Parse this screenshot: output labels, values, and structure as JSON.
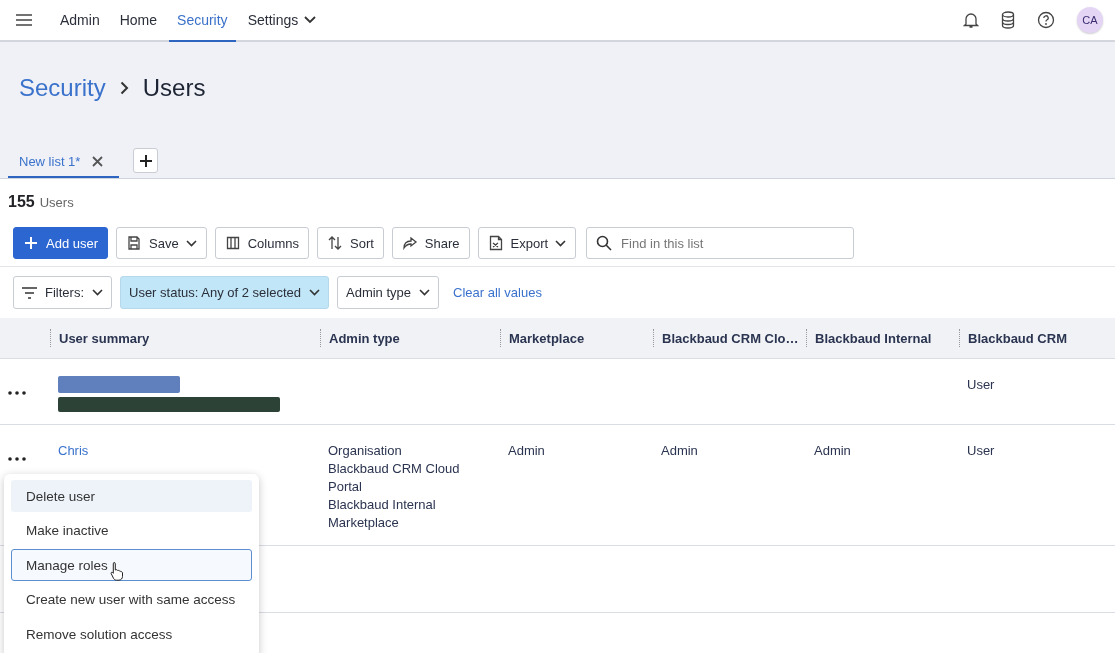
{
  "nav": {
    "items": [
      {
        "label": "Admin",
        "selected": false,
        "dropdown": false
      },
      {
        "label": "Home",
        "selected": false,
        "dropdown": false
      },
      {
        "label": "Security",
        "selected": true,
        "dropdown": false
      },
      {
        "label": "Settings",
        "selected": false,
        "dropdown": true
      }
    ],
    "avatar": "CA"
  },
  "breadcrumb": {
    "parent": "Security",
    "current": "Users"
  },
  "list_tabs": [
    {
      "label": "New list 1*",
      "selected": true
    }
  ],
  "count": {
    "number": "155",
    "label": "Users"
  },
  "toolbar": {
    "buttons": [
      {
        "kind": "primary",
        "label": "Add user",
        "dropdown": false
      },
      {
        "kind": "default",
        "label": "Save",
        "dropdown": true
      },
      {
        "kind": "default",
        "label": "Columns",
        "dropdown": false
      },
      {
        "kind": "default",
        "label": "Sort",
        "dropdown": false
      },
      {
        "kind": "default",
        "label": "Share",
        "dropdown": false
      },
      {
        "kind": "default",
        "label": "Export",
        "dropdown": true
      }
    ],
    "search": {
      "placeholder": "Find in this list"
    }
  },
  "filters": {
    "items": [
      {
        "kind": "menu",
        "label": "Filters:",
        "active": false
      },
      {
        "kind": "filter",
        "label": "User status: Any of 2 selected",
        "active": true
      },
      {
        "kind": "filter",
        "label": "Admin type",
        "active": false
      }
    ],
    "clear": "Clear all values"
  },
  "table": {
    "columns": [
      "User summary",
      "Admin type",
      "Marketplace",
      "Blackbaud CRM Clo…",
      "Blackbaud Internal",
      "Blackbaud CRM"
    ],
    "rows": [
      {
        "kind": "redacted",
        "cells": [
          "",
          "",
          "",
          "",
          "",
          "User"
        ]
      },
      {
        "kind": "user",
        "cells": [
          "Chris",
          "Organisation\nBlackbaud CRM Cloud\nPortal\nBlackbaud Internal\nMarketplace",
          "Admin",
          "Admin",
          "Admin",
          "User"
        ]
      },
      {
        "kind": "empty",
        "cells": [
          "",
          "",
          "",
          "",
          "",
          ""
        ]
      }
    ]
  },
  "context_menu": {
    "items": [
      {
        "label": "Delete user",
        "highlighted": true,
        "focused": false
      },
      {
        "label": "Make inactive",
        "highlighted": false,
        "focused": false
      },
      {
        "label": "Manage roles",
        "highlighted": false,
        "focused": true
      },
      {
        "label": "Create new user with same access",
        "highlighted": false,
        "focused": false
      },
      {
        "label": "Remove solution access",
        "highlighted": false,
        "focused": false
      }
    ]
  }
}
